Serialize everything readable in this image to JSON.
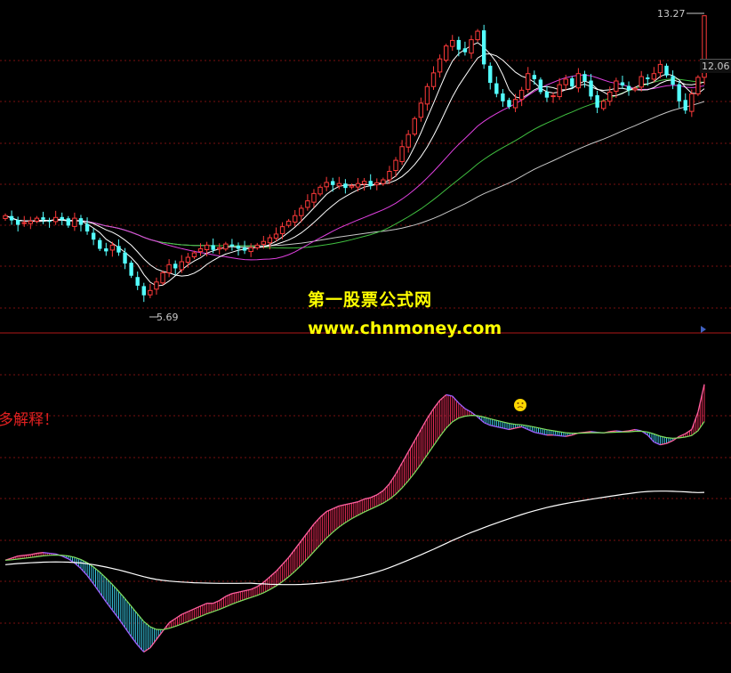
{
  "watermark": {
    "title": "第一股票公式网",
    "url": "www.chnmoney.com"
  },
  "note_text": "多解释！",
  "price_labels": {
    "high": "13.27",
    "low": "5.69",
    "current": "12.06"
  },
  "colors": {
    "background": "#000000",
    "up_candle": "#ff3a3a",
    "down_candle": "#54ffff",
    "ma_short": "#ffffff",
    "ma_mid": "#ffffff",
    "ma_long1": "#e040e0",
    "ma_long2": "#40c040",
    "ma_long3": "#c8c8c8",
    "macd_pos": "#ff3060",
    "macd_neg": "#40e0ff",
    "grid": "#7a1010",
    "marker": "#ffd700"
  },
  "chart_data": [
    {
      "type": "candlestick",
      "title": "",
      "ylim": [
        5.2,
        13.6
      ],
      "grid": true,
      "high_label": 13.27,
      "low_label": 5.69,
      "current_value": 12.06,
      "series_close": [
        7.85,
        7.72,
        7.6,
        7.66,
        7.7,
        7.78,
        7.74,
        7.7,
        7.8,
        7.74,
        7.58,
        7.78,
        7.6,
        7.42,
        7.2,
        6.95,
        6.88,
        7.05,
        6.85,
        6.55,
        6.22,
        5.95,
        5.69,
        5.82,
        6.05,
        6.3,
        6.52,
        6.42,
        6.6,
        6.72,
        6.84,
        6.95,
        7.05,
        6.92,
        6.98,
        7.08,
        7.02,
        6.95,
        6.9,
        6.98,
        7.05,
        7.15,
        7.25,
        7.35,
        7.55,
        7.7,
        7.85,
        8.05,
        8.25,
        8.45,
        8.62,
        8.75,
        8.68,
        8.72,
        8.6,
        8.66,
        8.72,
        8.78,
        8.65,
        8.74,
        8.82,
        9.05,
        9.35,
        9.72,
        10.05,
        10.48,
        10.9,
        11.35,
        11.72,
        12.1,
        12.45,
        12.6,
        12.35,
        12.28,
        12.62,
        12.85,
        11.95,
        11.45,
        11.15,
        10.95,
        10.8,
        11.0,
        11.25,
        11.7,
        11.55,
        11.2,
        11.05,
        11.1,
        11.4,
        11.55,
        11.35,
        11.7,
        11.5,
        11.08,
        10.78,
        10.95,
        11.2,
        11.5,
        11.38,
        11.25,
        11.3,
        11.62,
        11.55,
        11.7,
        11.95,
        11.65,
        11.4,
        10.95,
        10.7,
        11.15,
        11.6,
        12.06
      ]
    },
    {
      "type": "line",
      "title": "",
      "ylim": [
        -1.6,
        2.6
      ],
      "grid": true,
      "series_diff": [
        -0.08,
        -0.05,
        -0.02,
        -0.01,
        0.0,
        0.02,
        0.03,
        0.02,
        0.01,
        -0.02,
        -0.06,
        -0.12,
        -0.2,
        -0.3,
        -0.42,
        -0.55,
        -0.68,
        -0.8,
        -0.92,
        -1.05,
        -1.18,
        -1.3,
        -1.4,
        -1.34,
        -1.22,
        -1.1,
        -0.98,
        -0.92,
        -0.86,
        -0.82,
        -0.78,
        -0.74,
        -0.7,
        -0.7,
        -0.66,
        -0.6,
        -0.56,
        -0.54,
        -0.52,
        -0.5,
        -0.46,
        -0.4,
        -0.32,
        -0.24,
        -0.14,
        -0.04,
        0.08,
        0.2,
        0.32,
        0.44,
        0.54,
        0.62,
        0.66,
        0.7,
        0.72,
        0.74,
        0.76,
        0.8,
        0.82,
        0.86,
        0.92,
        1.02,
        1.16,
        1.32,
        1.48,
        1.64,
        1.8,
        1.96,
        2.1,
        2.22,
        2.3,
        2.28,
        2.18,
        2.1,
        2.05,
        1.98,
        1.9,
        1.86,
        1.84,
        1.82,
        1.8,
        1.82,
        1.84,
        1.8,
        1.76,
        1.74,
        1.72,
        1.72,
        1.71,
        1.7,
        1.72,
        1.75,
        1.76,
        1.77,
        1.76,
        1.75,
        1.77,
        1.78,
        1.77,
        1.78,
        1.8,
        1.78,
        1.72,
        1.62,
        1.58,
        1.6,
        1.64,
        1.7,
        1.74,
        1.8,
        2.05,
        2.45
      ]
    }
  ]
}
